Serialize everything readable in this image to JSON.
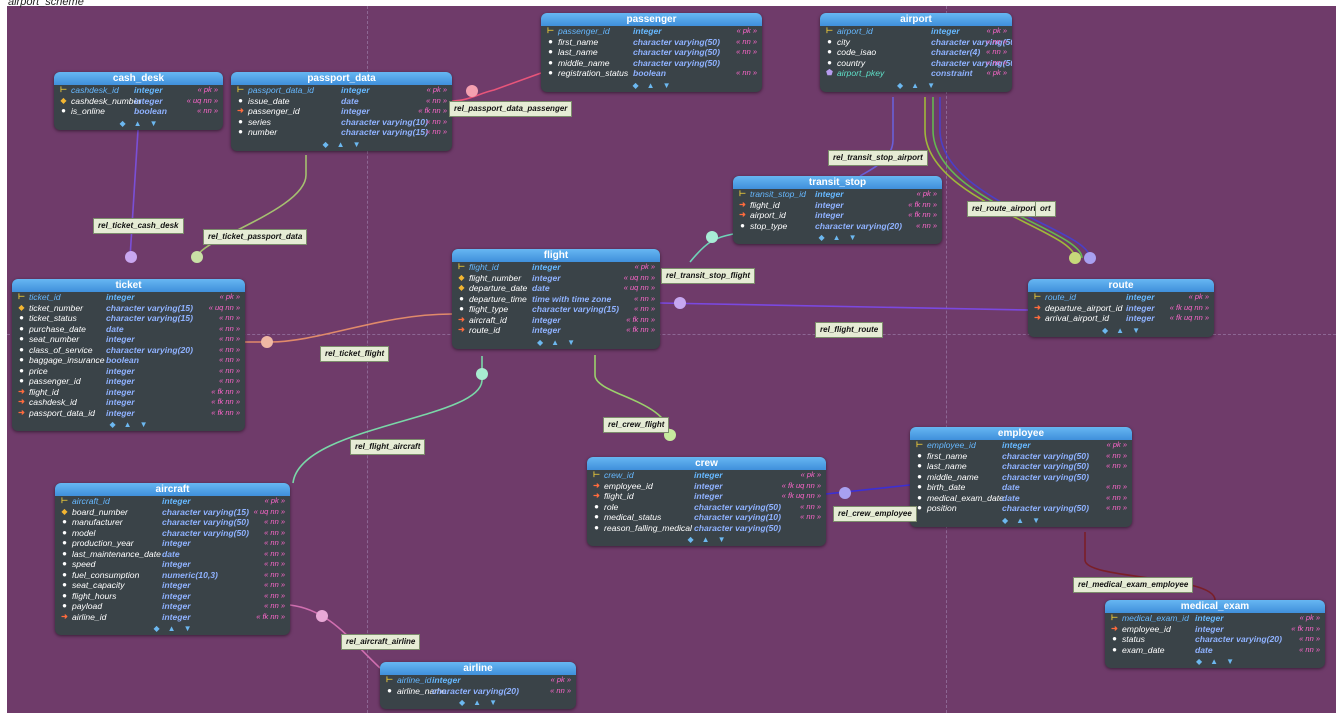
{
  "schema_title": "airport_scheme",
  "entities": [
    {
      "id": "passenger",
      "title": "passenger",
      "cols": [
        {
          "k": "pk",
          "name": "passenger_id",
          "type": "integer",
          "flags": "« pk »"
        },
        {
          "k": "col",
          "name": "first_name",
          "type": "character varying(50)",
          "flags": "« nn »"
        },
        {
          "k": "col",
          "name": "last_name",
          "type": "character varying(50)",
          "flags": "« nn »"
        },
        {
          "k": "col",
          "name": "middle_name",
          "type": "character varying(50)",
          "flags": ""
        },
        {
          "k": "col",
          "name": "registration_status",
          "type": "boolean",
          "flags": "« nn »"
        }
      ]
    },
    {
      "id": "airport",
      "title": "airport",
      "cols": [
        {
          "k": "pk",
          "name": "airport_id",
          "type": "integer",
          "flags": "« pk »"
        },
        {
          "k": "col",
          "name": "city",
          "type": "character varying(50)",
          "flags": "« nn »"
        },
        {
          "k": "col",
          "name": "code_isao",
          "type": "character(4)",
          "flags": "« nn »"
        },
        {
          "k": "col",
          "name": "country",
          "type": "character varying(50)",
          "flags": "« nn »"
        },
        {
          "k": "cons",
          "name": "airport_pkey",
          "type": "constraint",
          "flags": "« pk »"
        }
      ]
    },
    {
      "id": "cash_desk",
      "title": "cash_desk",
      "cols": [
        {
          "k": "pk",
          "name": "cashdesk_id",
          "type": "integer",
          "flags": "« pk »"
        },
        {
          "k": "uq",
          "name": "cashdesk_number",
          "type": "integer",
          "flags": "« uq nn »"
        },
        {
          "k": "col",
          "name": "is_online",
          "type": "boolean",
          "flags": "« nn »"
        }
      ]
    },
    {
      "id": "passport_data",
      "title": "passport_data",
      "cols": [
        {
          "k": "pk",
          "name": "passport_data_id",
          "type": "integer",
          "flags": "« pk »"
        },
        {
          "k": "col",
          "name": "issue_date",
          "type": "date",
          "flags": "« nn »"
        },
        {
          "k": "fk",
          "name": "passenger_id",
          "type": "integer",
          "flags": "« fk nn »"
        },
        {
          "k": "col",
          "name": "series",
          "type": "character varying(10)",
          "flags": "« nn »"
        },
        {
          "k": "col",
          "name": "number",
          "type": "character varying(15)",
          "flags": "« nn »"
        }
      ]
    },
    {
      "id": "transit_stop",
      "title": "transit_stop",
      "cols": [
        {
          "k": "pk",
          "name": "transit_stop_id",
          "type": "integer",
          "flags": "« pk »"
        },
        {
          "k": "fk",
          "name": "flight_id",
          "type": "integer",
          "flags": "« fk nn »"
        },
        {
          "k": "fk",
          "name": "airport_id",
          "type": "integer",
          "flags": "« fk nn »"
        },
        {
          "k": "col",
          "name": "stop_type",
          "type": "character varying(20)",
          "flags": "« nn »"
        }
      ]
    },
    {
      "id": "flight",
      "title": "flight",
      "cols": [
        {
          "k": "pk",
          "name": "flight_id",
          "type": "integer",
          "flags": "« pk »"
        },
        {
          "k": "uq",
          "name": "flight_number",
          "type": "integer",
          "flags": "« uq nn »"
        },
        {
          "k": "uq",
          "name": "departure_date",
          "type": "date",
          "flags": "« uq nn »"
        },
        {
          "k": "col",
          "name": "departure_time",
          "type": "time with time zone",
          "flags": "« nn »"
        },
        {
          "k": "col",
          "name": "flight_type",
          "type": "character varying(15)",
          "flags": "« nn »"
        },
        {
          "k": "fk",
          "name": "aircraft_id",
          "type": "integer",
          "flags": "« fk nn »"
        },
        {
          "k": "fk",
          "name": "route_id",
          "type": "integer",
          "flags": "« fk nn »"
        }
      ]
    },
    {
      "id": "route",
      "title": "route",
      "cols": [
        {
          "k": "pk",
          "name": "route_id",
          "type": "integer",
          "flags": "« pk »"
        },
        {
          "k": "fk",
          "name": "departure_airport_id",
          "type": "integer",
          "flags": "« fk uq nn »"
        },
        {
          "k": "fk",
          "name": "arrival_airport_id",
          "type": "integer",
          "flags": "« fk uq nn »"
        }
      ]
    },
    {
      "id": "ticket",
      "title": "ticket",
      "cols": [
        {
          "k": "pk",
          "name": "ticket_id",
          "type": "integer",
          "flags": "« pk »"
        },
        {
          "k": "uq",
          "name": "ticket_number",
          "type": "character varying(15)",
          "flags": "« uq nn »"
        },
        {
          "k": "col",
          "name": "ticket_status",
          "type": "character varying(15)",
          "flags": "« nn »"
        },
        {
          "k": "col",
          "name": "purchase_date",
          "type": "date",
          "flags": "« nn »"
        },
        {
          "k": "col",
          "name": "seat_number",
          "type": "integer",
          "flags": "« nn »"
        },
        {
          "k": "col",
          "name": "class_of_service",
          "type": "character varying(20)",
          "flags": "« nn »"
        },
        {
          "k": "col",
          "name": "baggage_insurance",
          "type": "boolean",
          "flags": "« nn »"
        },
        {
          "k": "col",
          "name": "price",
          "type": "integer",
          "flags": "« nn »"
        },
        {
          "k": "col",
          "name": "passenger_id",
          "type": "integer",
          "flags": "« nn »"
        },
        {
          "k": "fk",
          "name": "flight_id",
          "type": "integer",
          "flags": "« fk nn »"
        },
        {
          "k": "fk",
          "name": "cashdesk_id",
          "type": "integer",
          "flags": "« fk nn »"
        },
        {
          "k": "fk",
          "name": "passport_data_id",
          "type": "integer",
          "flags": "« fk nn »"
        }
      ]
    },
    {
      "id": "employee",
      "title": "employee",
      "cols": [
        {
          "k": "pk",
          "name": "employee_id",
          "type": "integer",
          "flags": "« pk »"
        },
        {
          "k": "col",
          "name": "first_name",
          "type": "character varying(50)",
          "flags": "« nn »"
        },
        {
          "k": "col",
          "name": "last_name",
          "type": "character varying(50)",
          "flags": "« nn »"
        },
        {
          "k": "col",
          "name": "middle_name",
          "type": "character varying(50)",
          "flags": ""
        },
        {
          "k": "col",
          "name": "birth_date",
          "type": "date",
          "flags": "« nn »"
        },
        {
          "k": "col",
          "name": "medical_exam_date",
          "type": "date",
          "flags": "« nn »"
        },
        {
          "k": "col",
          "name": "position",
          "type": "character varying(50)",
          "flags": "« nn »"
        }
      ]
    },
    {
      "id": "crew",
      "title": "crew",
      "cols": [
        {
          "k": "pk",
          "name": "crew_id",
          "type": "integer",
          "flags": "« pk »"
        },
        {
          "k": "fk",
          "name": "employee_id",
          "type": "integer",
          "flags": "« fk uq nn »"
        },
        {
          "k": "fk",
          "name": "flight_id",
          "type": "integer",
          "flags": "« fk uq nn »"
        },
        {
          "k": "col",
          "name": "role",
          "type": "character varying(50)",
          "flags": "« nn »"
        },
        {
          "k": "col",
          "name": "medical_status",
          "type": "character varying(10)",
          "flags": "« nn »"
        },
        {
          "k": "col",
          "name": "reason_falling_medical",
          "type": "character varying(50)",
          "flags": ""
        }
      ]
    },
    {
      "id": "aircraft",
      "title": "aircraft",
      "cols": [
        {
          "k": "pk",
          "name": "aircraft_id",
          "type": "integer",
          "flags": "« pk »"
        },
        {
          "k": "uq",
          "name": "board_number",
          "type": "character varying(15)",
          "flags": "« uq nn »"
        },
        {
          "k": "col",
          "name": "manufacturer",
          "type": "character varying(50)",
          "flags": "« nn »"
        },
        {
          "k": "col",
          "name": "model",
          "type": "character varying(50)",
          "flags": "« nn »"
        },
        {
          "k": "col",
          "name": "production_year",
          "type": "integer",
          "flags": "« nn »"
        },
        {
          "k": "col",
          "name": "last_maintenance_date",
          "type": "date",
          "flags": "« nn »"
        },
        {
          "k": "col",
          "name": "speed",
          "type": "integer",
          "flags": "« nn »"
        },
        {
          "k": "col",
          "name": "fuel_consumption",
          "type": "numeric(10,3)",
          "flags": "« nn »"
        },
        {
          "k": "col",
          "name": "seat_capacity",
          "type": "integer",
          "flags": "« nn »"
        },
        {
          "k": "col",
          "name": "flight_hours",
          "type": "integer",
          "flags": "« nn »"
        },
        {
          "k": "col",
          "name": "payload",
          "type": "integer",
          "flags": "« nn »"
        },
        {
          "k": "fk",
          "name": "airline_id",
          "type": "integer",
          "flags": "« fk nn »"
        }
      ]
    },
    {
      "id": "medical_exam",
      "title": "medical_exam",
      "cols": [
        {
          "k": "pk",
          "name": "medical_exam_id",
          "type": "integer",
          "flags": "« pk »"
        },
        {
          "k": "fk",
          "name": "employee_id",
          "type": "integer",
          "flags": "« fk nn »"
        },
        {
          "k": "col",
          "name": "status",
          "type": "character varying(20)",
          "flags": "« nn »"
        },
        {
          "k": "col",
          "name": "exam_date",
          "type": "date",
          "flags": "« nn »"
        }
      ]
    },
    {
      "id": "airline",
      "title": "airline",
      "cols": [
        {
          "k": "pk",
          "name": "airline_id",
          "type": "integer",
          "flags": "« pk »"
        },
        {
          "k": "col",
          "name": "airline_name",
          "type": "character varying(20)",
          "flags": "« nn »"
        }
      ]
    }
  ],
  "relations": [
    {
      "id": "passport_passenger",
      "label": "rel_passport_data_passenger",
      "color": "#e8557a"
    },
    {
      "id": "transit_airport",
      "label": "rel_transit_stop_airport",
      "color": "#6a5fd8"
    },
    {
      "id": "route_airport",
      "label": "rel_route_airport1",
      "color": "#a0b83a"
    },
    {
      "id": "route_airport2",
      "label": "ort",
      "color": "#4b3fc6"
    },
    {
      "id": "ticket_cash",
      "label": "rel_ticket_cash_desk",
      "color": "#7a4fd6"
    },
    {
      "id": "ticket_passport",
      "label": "rel_ticket_passport_data",
      "color": "#a5c070"
    },
    {
      "id": "transit_flight",
      "label": "rel_transit_stop_flight",
      "color": "#6fd3b8"
    },
    {
      "id": "flight_route",
      "label": "rel_flight_route",
      "color": "#7b48e0"
    },
    {
      "id": "ticket_flight",
      "label": "rel_ticket_flight",
      "color": "#e08a6a"
    },
    {
      "id": "crew_flight",
      "label": "rel_crew_flight",
      "color": "#9bd06c"
    },
    {
      "id": "flight_aircraft",
      "label": "rel_flight_aircraft",
      "color": "#7ad7a8"
    },
    {
      "id": "crew_employee",
      "label": "rel_crew_employee",
      "color": "#3b2fd6"
    },
    {
      "id": "medical_employee",
      "label": "rel_medical_exam_employee",
      "color": "#7a1f28"
    },
    {
      "id": "aircraft_airline",
      "label": "rel_aircraft_airline",
      "color": "#d06fb0"
    }
  ],
  "footer_icons": [
    "◆",
    "▲",
    "▼"
  ]
}
